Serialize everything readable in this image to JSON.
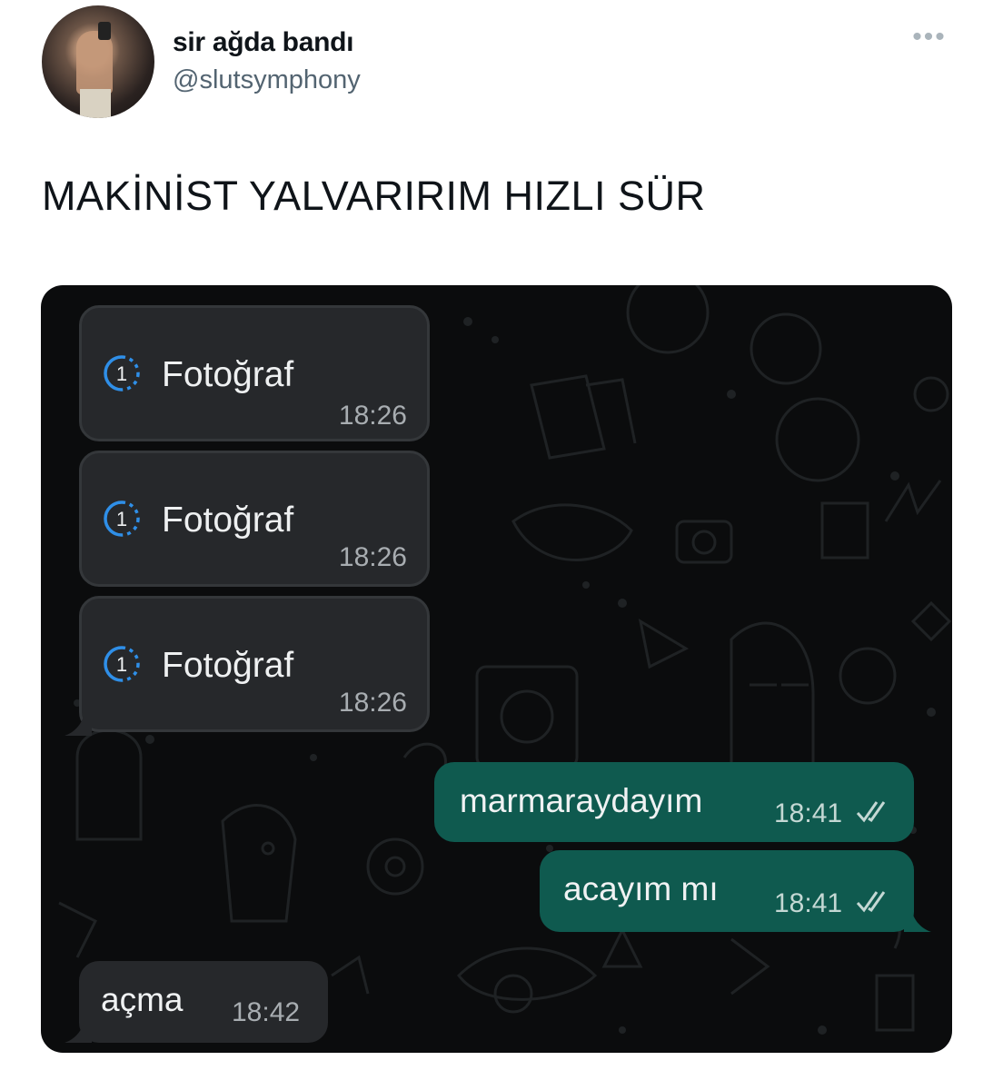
{
  "tweet": {
    "author": {
      "display_name": "sir ağda bandı",
      "handle": "@slutsymphony"
    },
    "more_label": "•••",
    "text": "MAKİNİST YALVARIRIM HIZLI SÜR"
  },
  "chat": {
    "messages": [
      {
        "direction": "incoming",
        "type": "photo",
        "icon": "view-once-icon",
        "icon_number": "1",
        "label": "Fotoğraf",
        "time": "18:26"
      },
      {
        "direction": "incoming",
        "type": "photo",
        "icon": "view-once-icon",
        "icon_number": "1",
        "label": "Fotoğraf",
        "time": "18:26"
      },
      {
        "direction": "incoming",
        "type": "photo",
        "icon": "view-once-icon",
        "icon_number": "1",
        "label": "Fotoğraf",
        "time": "18:26"
      },
      {
        "direction": "outgoing",
        "type": "text",
        "text": "marmaraydayım",
        "time": "18:41",
        "status_icon": "double-check-icon"
      },
      {
        "direction": "outgoing",
        "type": "text",
        "text": "acayım mı",
        "time": "18:41",
        "status_icon": "double-check-icon"
      },
      {
        "direction": "incoming",
        "type": "text",
        "text": "açma",
        "time": "18:42"
      }
    ],
    "colors": {
      "background": "#0b0c0d",
      "incoming": "#26282b",
      "outgoing": "#0f5a4f",
      "accent": "#2f8fe8"
    }
  }
}
